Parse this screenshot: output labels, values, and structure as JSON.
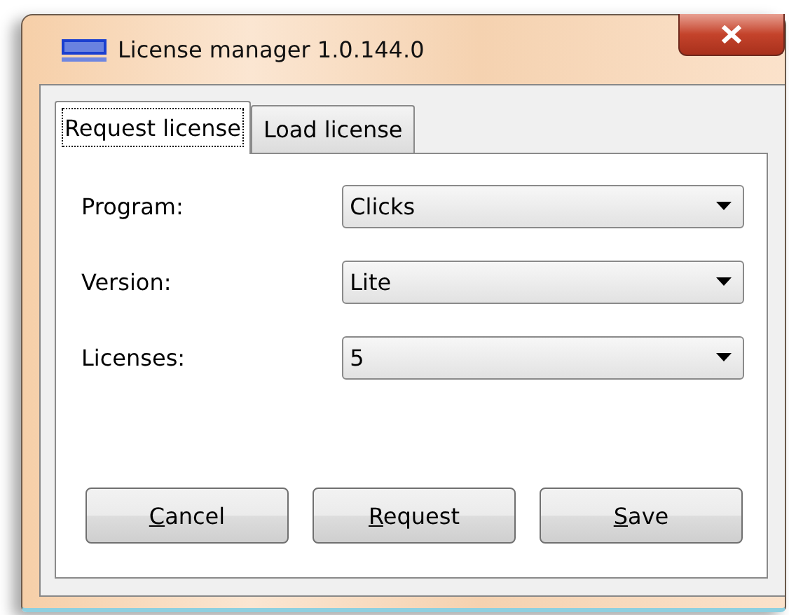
{
  "window": {
    "title": "License manager 1.0.144.0"
  },
  "tabs": [
    {
      "label": "Request license",
      "selected": true
    },
    {
      "label": "Load license",
      "selected": false
    }
  ],
  "fields": [
    {
      "label": "Program:",
      "value": "Clicks"
    },
    {
      "label": "Version:",
      "value": "Lite"
    },
    {
      "label": "Licenses:",
      "value": "5"
    }
  ],
  "buttons": [
    {
      "accel": "C",
      "rest": "ancel"
    },
    {
      "accel": "R",
      "rest": "equest"
    },
    {
      "accel": "S",
      "rest": "ave"
    }
  ]
}
